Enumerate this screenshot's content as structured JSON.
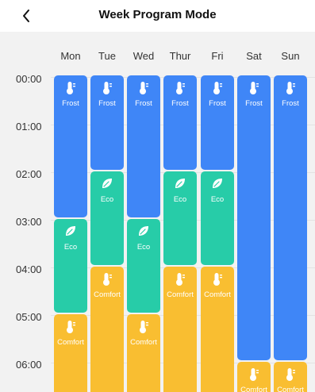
{
  "header": {
    "title": "Week Program Mode"
  },
  "days": [
    "Mon",
    "Tue",
    "Wed",
    "Thur",
    "Fri",
    "Sat",
    "Sun"
  ],
  "times": [
    "00:00",
    "01:00",
    "02:00",
    "03:00",
    "04:00",
    "05:00",
    "06:00"
  ],
  "modes": {
    "frost": {
      "label": "Frost",
      "color": "#3f86f7",
      "icon": "thermometer-icon"
    },
    "eco": {
      "label": "Eco",
      "color": "#27cca8",
      "icon": "leaf-icon"
    },
    "comfort": {
      "label": "Comfort",
      "color": "#f9be31",
      "icon": "thermometer-icon"
    }
  },
  "schedule": [
    {
      "day": "Mon",
      "segments": [
        {
          "mode": "frost",
          "start": 0,
          "end": 3
        },
        {
          "mode": "eco",
          "start": 3,
          "end": 5
        },
        {
          "mode": "comfort",
          "start": 5,
          "end": 7
        }
      ]
    },
    {
      "day": "Tue",
      "segments": [
        {
          "mode": "frost",
          "start": 0,
          "end": 2
        },
        {
          "mode": "eco",
          "start": 2,
          "end": 4
        },
        {
          "mode": "comfort",
          "start": 4,
          "end": 7
        }
      ]
    },
    {
      "day": "Wed",
      "segments": [
        {
          "mode": "frost",
          "start": 0,
          "end": 3
        },
        {
          "mode": "eco",
          "start": 3,
          "end": 5
        },
        {
          "mode": "comfort",
          "start": 5,
          "end": 7
        }
      ]
    },
    {
      "day": "Thur",
      "segments": [
        {
          "mode": "frost",
          "start": 0,
          "end": 2
        },
        {
          "mode": "eco",
          "start": 2,
          "end": 4
        },
        {
          "mode": "comfort",
          "start": 4,
          "end": 7
        }
      ]
    },
    {
      "day": "Fri",
      "segments": [
        {
          "mode": "frost",
          "start": 0,
          "end": 2
        },
        {
          "mode": "eco",
          "start": 2,
          "end": 4
        },
        {
          "mode": "comfort",
          "start": 4,
          "end": 7
        }
      ]
    },
    {
      "day": "Sat",
      "segments": [
        {
          "mode": "frost",
          "start": 0,
          "end": 6
        },
        {
          "mode": "comfort",
          "start": 6,
          "end": 7
        }
      ]
    },
    {
      "day": "Sun",
      "segments": [
        {
          "mode": "frost",
          "start": 0,
          "end": 6
        },
        {
          "mode": "comfort",
          "start": 6,
          "end": 7
        }
      ]
    }
  ]
}
